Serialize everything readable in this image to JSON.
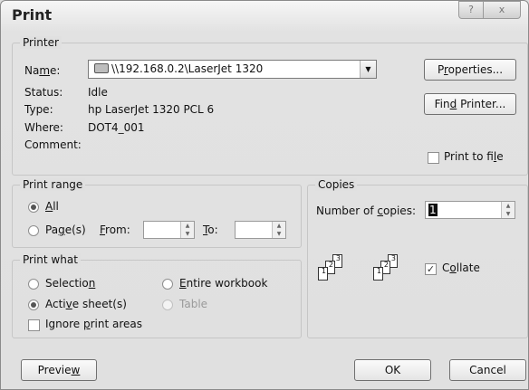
{
  "window": {
    "title": "Print",
    "help_glyph": "?",
    "close_glyph": "x"
  },
  "printer": {
    "group_title": "Printer",
    "name_label": "Name:",
    "name_value": "\\\\192.168.0.2\\LaserJet 1320",
    "status_label": "Status:",
    "status_value": "Idle",
    "type_label": "Type:",
    "type_value": "hp LaserJet 1320 PCL 6",
    "where_label": "Where:",
    "where_value": "DOT4_001",
    "comment_label": "Comment:",
    "properties_button": "Properties...",
    "find_printer_button": "Find Printer...",
    "print_to_file_label": "Print to file",
    "print_to_file_checked": false
  },
  "print_range": {
    "group_title": "Print range",
    "all_label": "All",
    "pages_label": "Page(s)",
    "from_label": "From:",
    "to_label": "To:",
    "from_value": "",
    "to_value": "",
    "selected": "All"
  },
  "print_what": {
    "group_title": "Print what",
    "selection_label": "Selection",
    "entire_workbook_label": "Entire workbook",
    "active_sheets_label": "Active sheet(s)",
    "table_label": "Table",
    "ignore_areas_label": "Ignore print areas",
    "selected": "Active sheet(s)",
    "ignore_areas_checked": false
  },
  "copies": {
    "group_title": "Copies",
    "number_label": "Number of copies:",
    "number_value": "1",
    "collate_label": "Collate",
    "collate_checked": true,
    "page_numbers": [
      "1",
      "2",
      "3"
    ]
  },
  "footer": {
    "preview_button": "Preview",
    "ok_button": "OK",
    "cancel_button": "Cancel"
  },
  "icons": {
    "combo_arrow": "▼",
    "spin_up": "▲",
    "spin_down": "▼",
    "check": "✓"
  }
}
